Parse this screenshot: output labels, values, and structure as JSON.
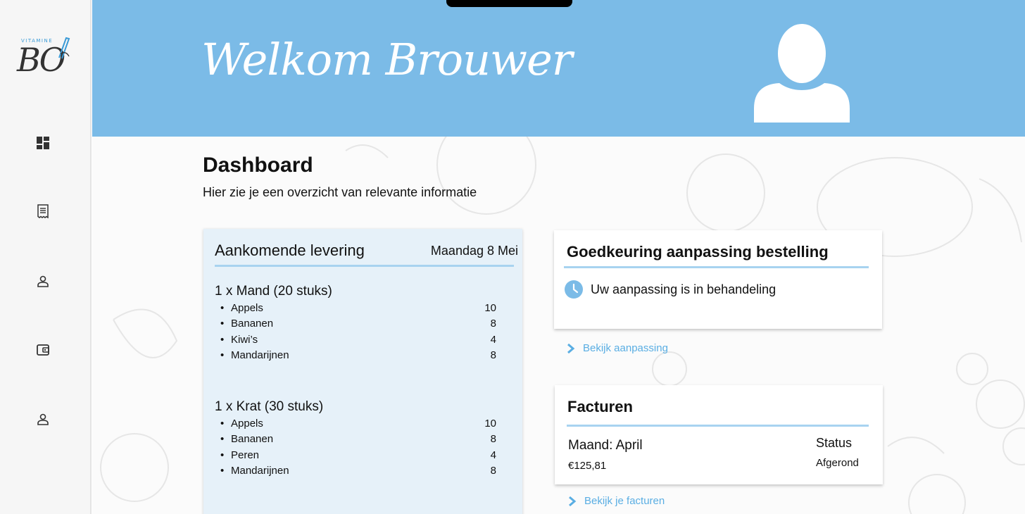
{
  "brand": {
    "tagline": "VITAMINE",
    "mark": "BO"
  },
  "sidebar": {
    "items": [
      {
        "name": "dashboard-icon"
      },
      {
        "name": "orders-icon"
      },
      {
        "name": "profile-icon"
      },
      {
        "name": "wallet-icon"
      },
      {
        "name": "account-icon"
      }
    ]
  },
  "header": {
    "welcome": "Welkom Brouwer",
    "accent": "#7bbbe7"
  },
  "page": {
    "title": "Dashboard",
    "subtitle": "Hier zie je een overzicht van relevante informatie"
  },
  "delivery": {
    "title": "Aankomende levering",
    "date": "Maandag 8 Mei",
    "groups": [
      {
        "title": "1 x Mand (20 stuks)",
        "items": [
          {
            "name": "Appels",
            "qty": "10"
          },
          {
            "name": "Bananen",
            "qty": "8"
          },
          {
            "name": "Kiwi’s",
            "qty": "4"
          },
          {
            "name": "Mandarijnen",
            "qty": "8"
          }
        ]
      },
      {
        "title": "1 x Krat (30 stuks)",
        "items": [
          {
            "name": "Appels",
            "qty": "10"
          },
          {
            "name": "Bananen",
            "qty": "8"
          },
          {
            "name": "Peren",
            "qty": "4"
          },
          {
            "name": "Mandarijnen",
            "qty": "8"
          }
        ]
      }
    ]
  },
  "approval": {
    "title": "Goedkeuring aanpassing bestelling",
    "status": "Uw aanpassing is in behandeling",
    "link": "Bekijk aanpassing"
  },
  "invoices": {
    "title": "Facturen",
    "month": "Maand: April",
    "amount": "€125,81",
    "status_label": "Status",
    "status_value": "Afgerond",
    "link": "Bekijk je facturen"
  }
}
